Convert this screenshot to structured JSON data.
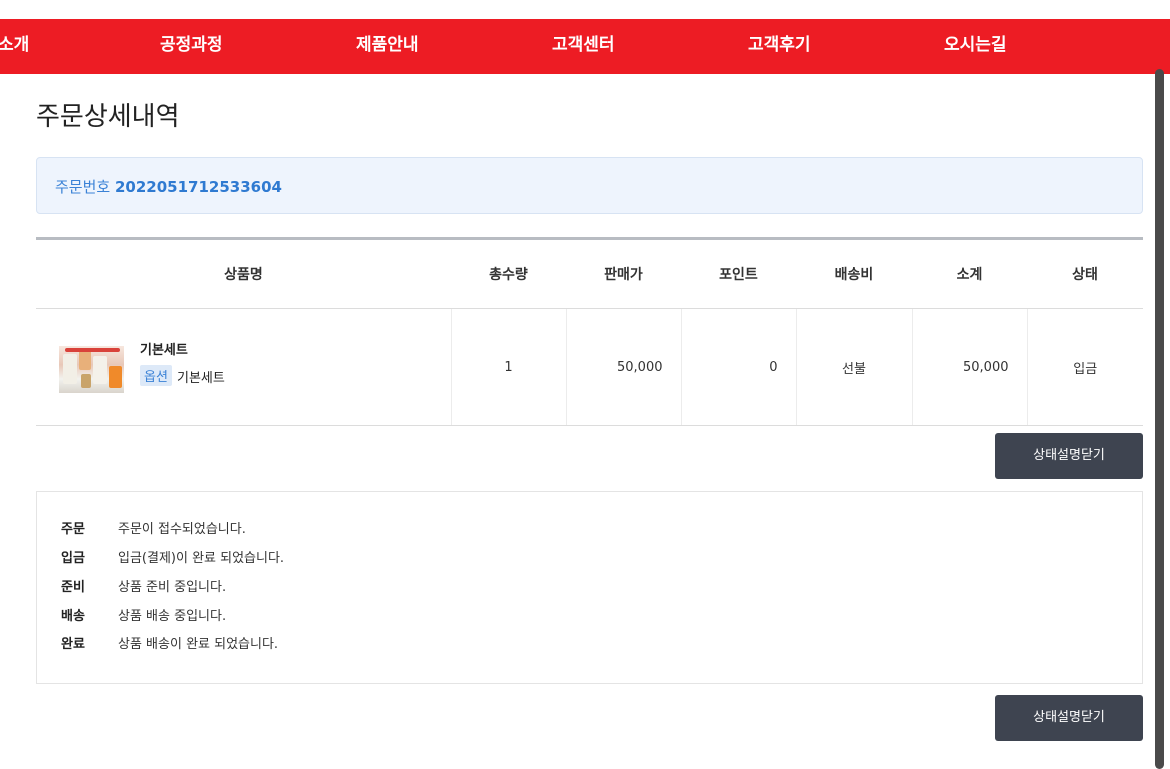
{
  "nav": {
    "items": [
      "소개",
      "공정과정",
      "제품안내",
      "고객센터",
      "고객후기",
      "오시는길"
    ]
  },
  "page": {
    "title": "주문상세내역"
  },
  "order": {
    "label": "주문번호",
    "number": "2022051712533604"
  },
  "table": {
    "headers": [
      "상품명",
      "총수량",
      "판매가",
      "포인트",
      "배송비",
      "소계",
      "상태"
    ],
    "rows": [
      {
        "name": "기본세트",
        "option_label": "옵션",
        "option_value": "기본세트",
        "qty": "1",
        "price": "50,000",
        "point": "0",
        "shipping": "선불",
        "subtotal": "50,000",
        "status": "입금"
      }
    ]
  },
  "buttons": {
    "close_status": "상태설명닫기"
  },
  "status_desc": [
    {
      "key": "주문",
      "text": "주문이 접수되었습니다."
    },
    {
      "key": "입금",
      "text": "입금(결제)이 완료 되었습니다."
    },
    {
      "key": "준비",
      "text": "상품 준비 중입니다."
    },
    {
      "key": "배송",
      "text": "상품 배송 중입니다."
    },
    {
      "key": "완료",
      "text": "상품 배송이 완료 되었습니다."
    }
  ],
  "colors": {
    "nav_bg": "#ed1c24",
    "button_bg": "#3e4450",
    "accent_blue": "#2f7ad1"
  }
}
